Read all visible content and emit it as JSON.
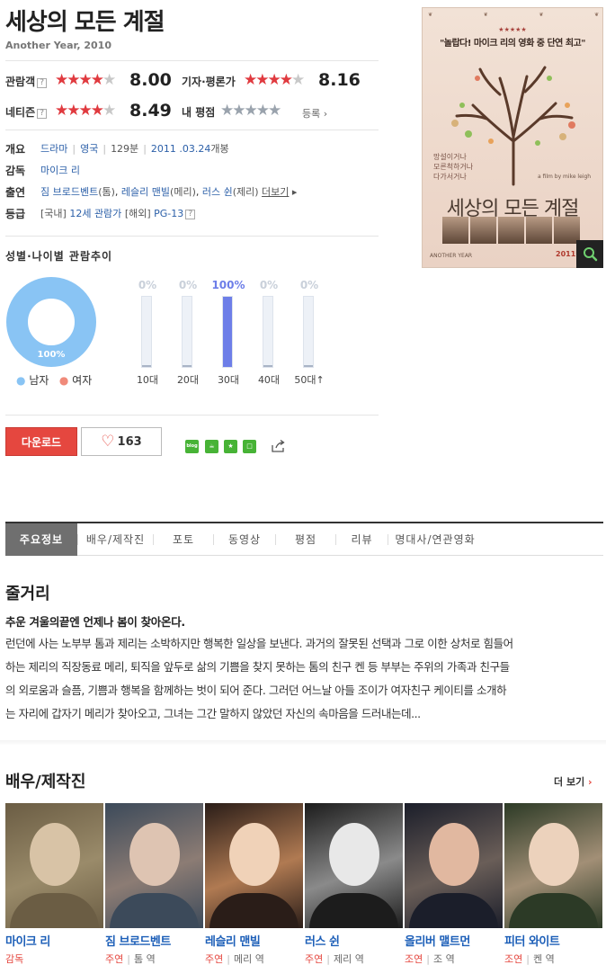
{
  "movie": {
    "title": "세상의 모든 계절",
    "original": "Another Year, 2010"
  },
  "ratings": {
    "audience": {
      "label": "관람객",
      "score": "8.00",
      "stars": 4
    },
    "critic": {
      "label": "기자·평론가",
      "score": "8.16",
      "stars": 4
    },
    "netizen": {
      "label": "네티즌",
      "score": "8.49",
      "stars": 4
    },
    "mine": {
      "label": "내 평점",
      "action": "등록",
      "stars": 0
    }
  },
  "info": {
    "overview_label": "개요",
    "genre": "드라마",
    "country": "영국",
    "runtime": "129분",
    "release_date": "2011 .03.24",
    "release_suffix": "개봉",
    "director_label": "감독",
    "director": "마이크 리",
    "cast_label": "출연",
    "cast1": "짐 브로드벤트",
    "cast1_role": "(톰)",
    "cast2": "레슬리 맨빌",
    "cast2_role": "(메리)",
    "cast3": "러스 쉰",
    "cast3_role": "(제리)",
    "more": "더보기",
    "grade_label": "등급",
    "grade_kr_prefix": "[국내]",
    "grade_kr": "12세 관람가",
    "grade_intl_prefix": "[해외]",
    "grade_intl": "PG-13"
  },
  "poster": {
    "tagline": "\"놀랍다! 마이크 리의 영화 중 단연 최고\"",
    "side_text": [
      "망설이거나",
      "모른척하거나",
      "다가서거나"
    ],
    "title": "세상의 모든 계절",
    "director_credit": "a film by mike leigh",
    "footer_left": "ANOTHER YEAR",
    "footer_right": "2011년"
  },
  "demographics": {
    "title": "성별·나이별 관람추이",
    "gender": {
      "male_label": "남자",
      "female_label": "여자",
      "male_pct_label": "100%",
      "male": 1.0,
      "female": 0.0
    },
    "ages": [
      {
        "label": "10대",
        "pct": "0%",
        "value": 0
      },
      {
        "label": "20대",
        "pct": "0%",
        "value": 0
      },
      {
        "label": "30대",
        "pct": "100%",
        "value": 100
      },
      {
        "label": "40대",
        "pct": "0%",
        "value": 0
      },
      {
        "label": "50대↑",
        "pct": "0%",
        "value": 0
      }
    ],
    "colors": {
      "male": "#89c4f4",
      "female": "#f08a7a",
      "bar": "#6d7ee8"
    }
  },
  "actions": {
    "download": "다운로드",
    "likes": "163",
    "share_blog": "blog"
  },
  "tabs": [
    "주요정보",
    "배우/제작진",
    "포토",
    "동영상",
    "평점",
    "리뷰",
    "명대사/연관영화"
  ],
  "synopsis": {
    "title": "줄거리",
    "headline": "추운 겨울의끝엔 언제나 봄이 찾아온다.",
    "lines": [
      "런던에 사는 노부부 톰과 제리는 소박하지만 행복한 일상을 보낸다. 과거의 잘못된 선택과 그로 이한 상처로 힘들어",
      "하는 제리의 직장동료 메리, 퇴직을 앞두로 삶의 기쁨을 찾지 못하는 톰의 친구 켄 등 부부는 주위의 가족과 친구들",
      "의 외로움과 슬픔, 기쁨과 행복을 함께하는 벗이 되어 준다. 그러던 어느날 아들 조이가 여자친구 케이티를 소개하",
      "는 자리에 갑자기 메리가 찾아오고, 그녀는 그간 말하지 않았던 자신의 속마음을 드러내는데..."
    ]
  },
  "cast": {
    "title": "배우/제작진",
    "more": "더 보기",
    "people": [
      {
        "name": "마이크 리",
        "role": "감독",
        "character": ""
      },
      {
        "name": "짐 브로드벤트",
        "role": "주연",
        "character": "톰 역"
      },
      {
        "name": "레슬리 맨빌",
        "role": "주연",
        "character": "메리 역"
      },
      {
        "name": "러스 쉰",
        "role": "주연",
        "character": "제리 역"
      },
      {
        "name": "올리버 맬트먼",
        "role": "조연",
        "character": "조 역"
      },
      {
        "name": "피터 와이트",
        "role": "조연",
        "character": "켄 역"
      }
    ]
  }
}
